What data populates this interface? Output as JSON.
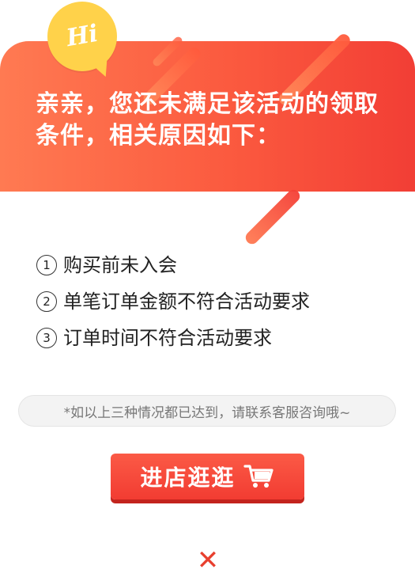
{
  "header": {
    "badge_text": "Hi",
    "title": "亲亲，您还未满足该活动的领取条件，相关原因如下："
  },
  "reasons": [
    {
      "num": "1",
      "text": "购买前未入会"
    },
    {
      "num": "2",
      "text": "单笔订单金额不符合活动要求"
    },
    {
      "num": "3",
      "text": "订单时间不符合活动要求"
    }
  ],
  "note": "*如以上三种情况都已达到，请联系客服咨询哦~",
  "button": {
    "label": "进店逛逛",
    "icon": "shopping-cart-icon"
  },
  "close": {
    "icon": "close-icon",
    "glyph": "✕"
  },
  "colors": {
    "header_start": "#ff7a52",
    "header_end": "#f23e35",
    "badge": "#ffd24a",
    "button": "#f23c32",
    "close": "#e8402f"
  }
}
